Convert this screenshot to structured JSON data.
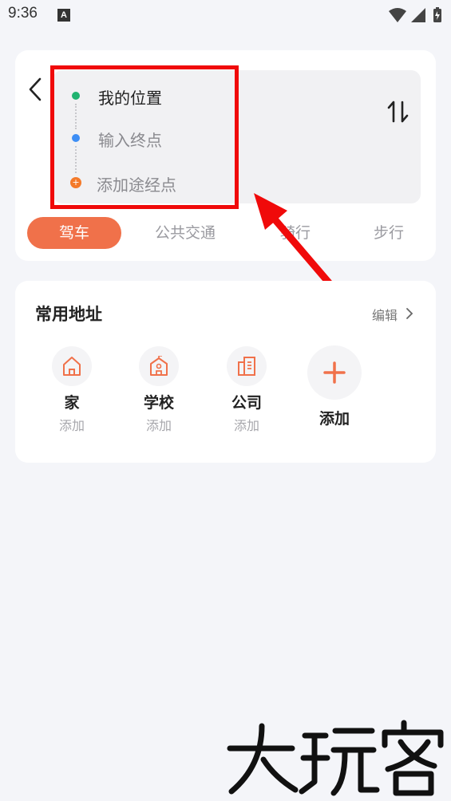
{
  "status_bar": {
    "time": "9:36",
    "notification_letter": "A"
  },
  "route": {
    "origin": "我的位置",
    "destination_placeholder": "输入终点",
    "waypoint_label": "添加途经点",
    "waypoint_badge": "+"
  },
  "modes": {
    "drive": "驾车",
    "transit": "公共交通",
    "ride": "骑行",
    "walk": "步行"
  },
  "addresses": {
    "title": "常用地址",
    "edit_label": "编辑",
    "items": [
      {
        "name": "家",
        "sub": "添加",
        "icon": "home-icon"
      },
      {
        "name": "学校",
        "sub": "添加",
        "icon": "school-icon"
      },
      {
        "name": "公司",
        "sub": "添加",
        "icon": "office-building-icon"
      },
      {
        "name": "添加",
        "icon": "plus-icon"
      }
    ]
  },
  "colors": {
    "accent": "#f0714a",
    "origin_dot": "#20b370",
    "destination_dot": "#3d8ef5",
    "waypoint_dot": "#f47a2a",
    "highlight": "#f00a0a"
  },
  "watermark": {
    "logo": "大玩客"
  }
}
